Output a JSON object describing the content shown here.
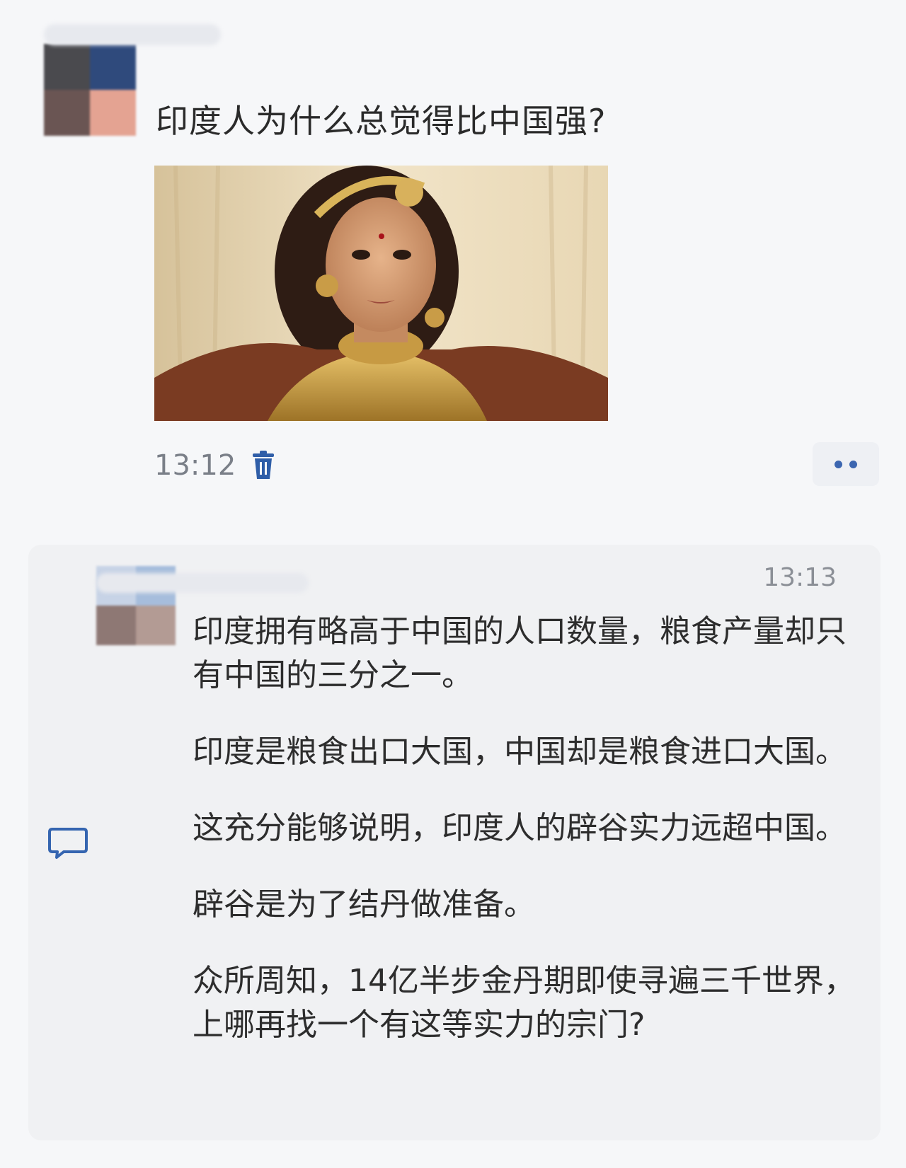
{
  "question": {
    "title": "印度人为什么总觉得比中国强?",
    "image_alt": "photo of a woman wearing gold jewelry",
    "time": "13:12",
    "delete_icon": "trash-icon",
    "more_icon": "more-dots-icon"
  },
  "answer": {
    "time": "13:13",
    "comment_icon": "comment-icon",
    "paragraphs": [
      "印度拥有略高于中国的人口数量，粮食产量却只有中国的三分之一。",
      "印度是粮食出口大国，中国却是粮食进口大国。",
      "这充分能够说明，印度人的辟谷实力远超中国。",
      "辟谷是为了结丹做准备。",
      "众所周知，14亿半步金丹期即使寻遍三千世界，上哪再找一个有这等实力的宗门?"
    ]
  },
  "colors": {
    "background": "#f6f7f9",
    "card": "#f0f1f3",
    "accent": "#3c66b0",
    "muted_text": "#7a7f88"
  }
}
